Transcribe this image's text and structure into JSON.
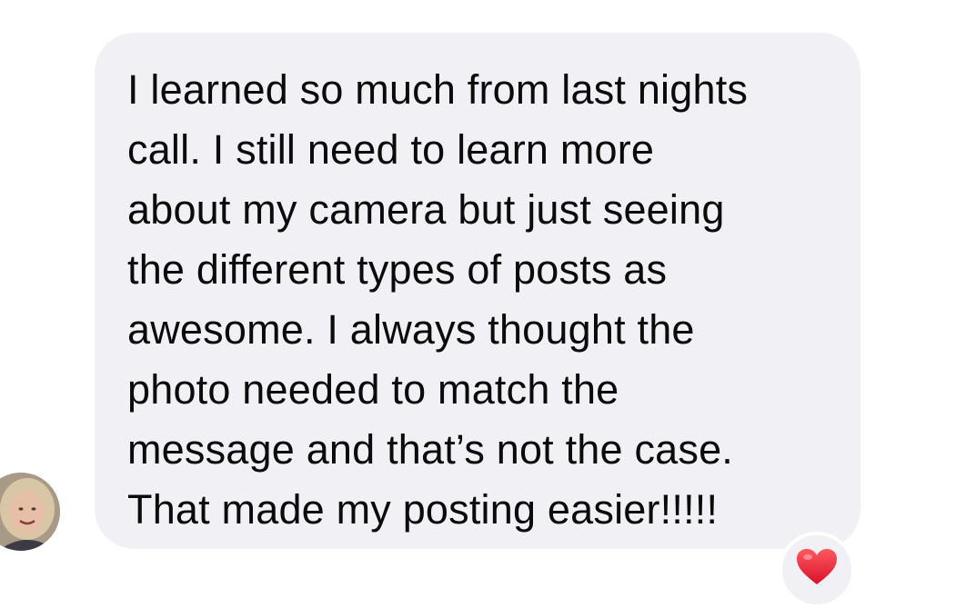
{
  "conversation": {
    "message": {
      "lines": [
        "I learned so much from last nights",
        "call. I still need to learn more",
        "about my camera but just seeing",
        "the different types of posts as",
        "awesome.  I always thought the",
        "photo needed to match the",
        "message and that’s not the case.",
        "That made my posting easier!!!!!"
      ],
      "bubble_color": "#f0f0f5",
      "text_color": "#0b0b0b"
    },
    "reaction": {
      "icon": "heart-icon",
      "color": "#e8243a"
    },
    "avatar": {
      "icon": "avatar"
    }
  }
}
